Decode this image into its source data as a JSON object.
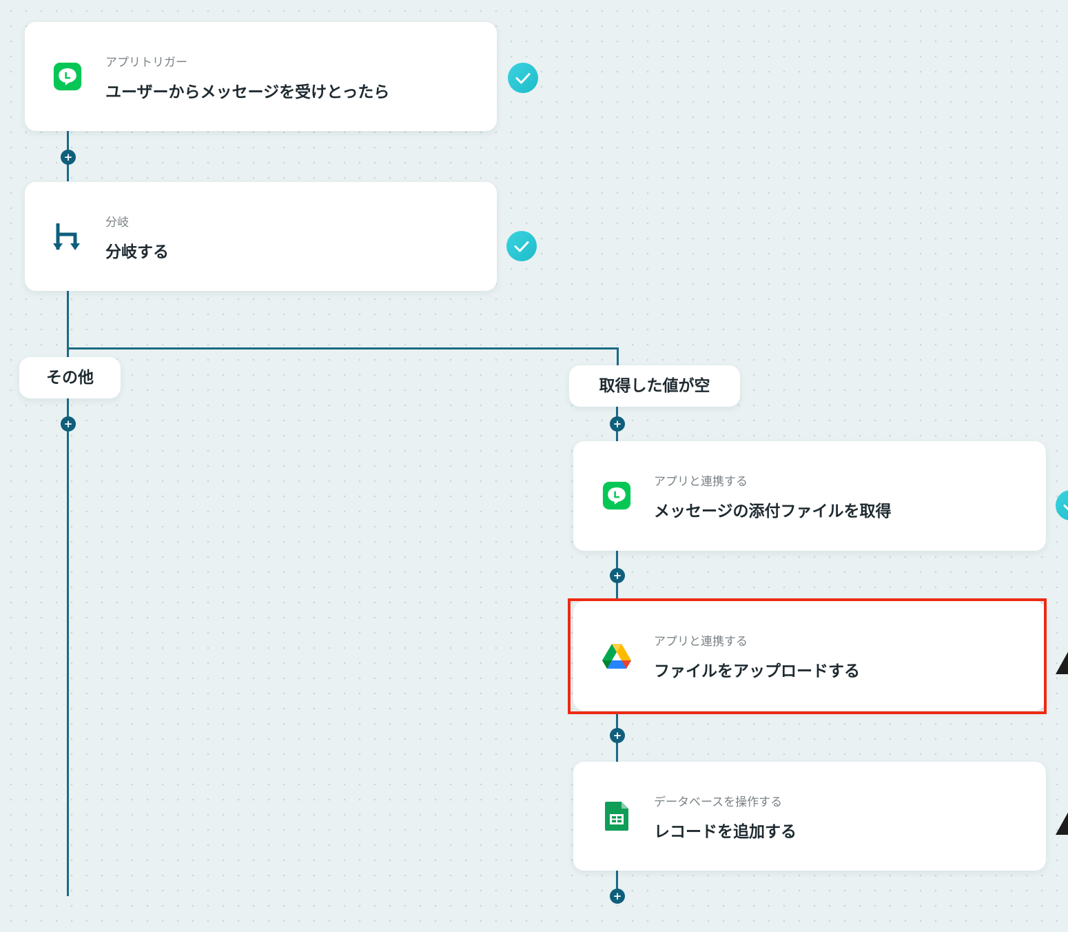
{
  "flow": {
    "trigger": {
      "kind": "アプリトリガー",
      "title": "ユーザーからメッセージを受けとったら",
      "icon": "line-app-icon"
    },
    "branch": {
      "kind": "分岐",
      "title": "分岐する",
      "icon": "branch-icon"
    },
    "branch_labels": {
      "other": "その他",
      "empty": "取得した値が空"
    },
    "steps": [
      {
        "kind": "アプリと連携する",
        "title": "メッセージの添付ファイルを取得",
        "icon": "line-app-icon"
      },
      {
        "kind": "アプリと連携する",
        "title": "ファイルをアップロードする",
        "icon": "google-drive-icon"
      },
      {
        "kind": "データベースを操作する",
        "title": "レコードを追加する",
        "icon": "google-sheets-icon"
      }
    ]
  },
  "colors": {
    "connector": "#1a6a86",
    "plus_button": "#0f5f7c",
    "check": "#2ac7d4",
    "highlight": "#ee2a12",
    "line_green": "#06c755"
  }
}
